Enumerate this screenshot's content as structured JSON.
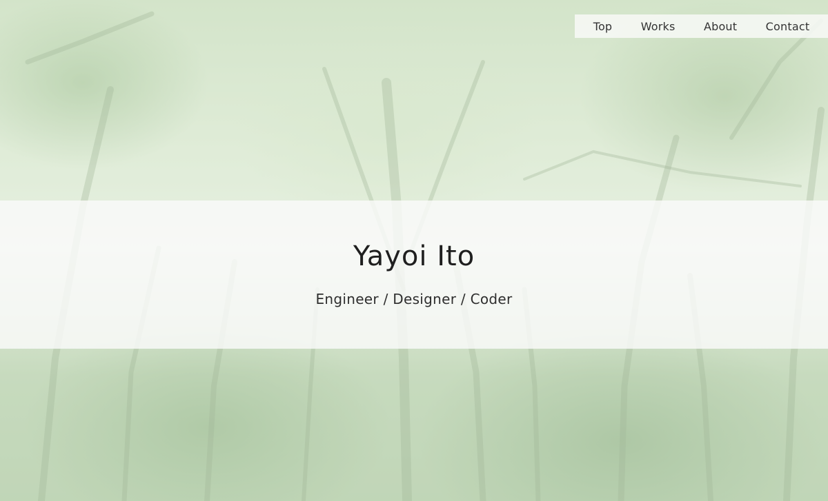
{
  "nav": {
    "items": [
      {
        "label": "Top"
      },
      {
        "label": "Works"
      },
      {
        "label": "About"
      },
      {
        "label": "Contact"
      }
    ]
  },
  "hero": {
    "title": "Yayoi Ito",
    "subtitle": "Engineer / Designer / Coder"
  }
}
